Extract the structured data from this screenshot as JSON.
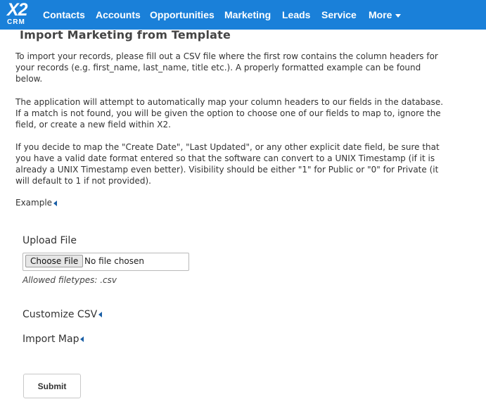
{
  "header": {
    "logo_top": "X2",
    "logo_bottom": "CRM",
    "nav_items": [
      "Contacts",
      "Accounts",
      "Opportunities",
      "Marketing",
      "Leads",
      "Service",
      "More"
    ]
  },
  "page": {
    "title": "Import Marketing from Template",
    "paragraphs": [
      "To import your records, please fill out a CSV file where the first row contains the column headers for your records (e.g. first_name, last_name, title etc.). A properly formatted example can be found below.",
      "The application will attempt to automatically map your column headers to our fields in the database. If a match is not found, you will be given the option to choose one of our fields to map to, ignore the field, or create a new field within X2.",
      "If you decide to map the \"Create Date\", \"Last Updated\", or any other explicit date field, be sure that you have a valid date format entered so that the software can convert to a UNIX Timestamp (if it is already a UNIX Timestamp even better). Visibility should be either \"1\" for Public or \"0\" for Private (it will default to 1 if not provided)."
    ],
    "example_label": "Example",
    "upload": {
      "label": "Upload File",
      "choose_button": "Choose File",
      "no_file_text": "No file chosen",
      "allowed_types": "Allowed filetypes: .csv"
    },
    "customize_label": "Customize CSV",
    "import_map_label": "Import Map",
    "submit_label": "Submit"
  }
}
